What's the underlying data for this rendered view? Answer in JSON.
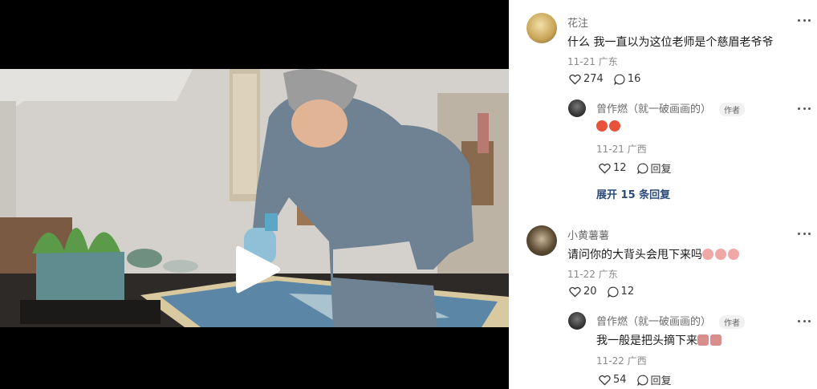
{
  "video": {
    "play_icon": "play-icon"
  },
  "comments": [
    {
      "user": "花注",
      "text": "什么 我一直以为这位老师是个慈眉老爷爷",
      "date": "11-21",
      "location": "广东",
      "likes": "274",
      "replies": "16"
    },
    {
      "user": "曾作燃（就一破画画的）",
      "badge": "作者",
      "emojis": [
        "red-devil-emoji",
        "red-devil-emoji"
      ],
      "date": "11-21",
      "location": "广西",
      "likes": "12",
      "reply_label": "回复"
    },
    {
      "expand_label": "展开 15 条回复"
    },
    {
      "user": "小黄薯薯",
      "text": "请问你的大背头会甩下来吗",
      "emojis": [
        "pig-emoji",
        "pig-emoji",
        "pig-emoji"
      ],
      "date": "11-22",
      "location": "广东",
      "likes": "20",
      "replies": "12"
    },
    {
      "user": "曾作燃（就一破画画的）",
      "badge": "作者",
      "text": "我一般是把头摘下来",
      "emojis": [
        "sticker-emoji",
        "sticker-emoji"
      ],
      "date": "11-22",
      "location": "广西",
      "likes": "54",
      "reply_label": "回复"
    }
  ]
}
